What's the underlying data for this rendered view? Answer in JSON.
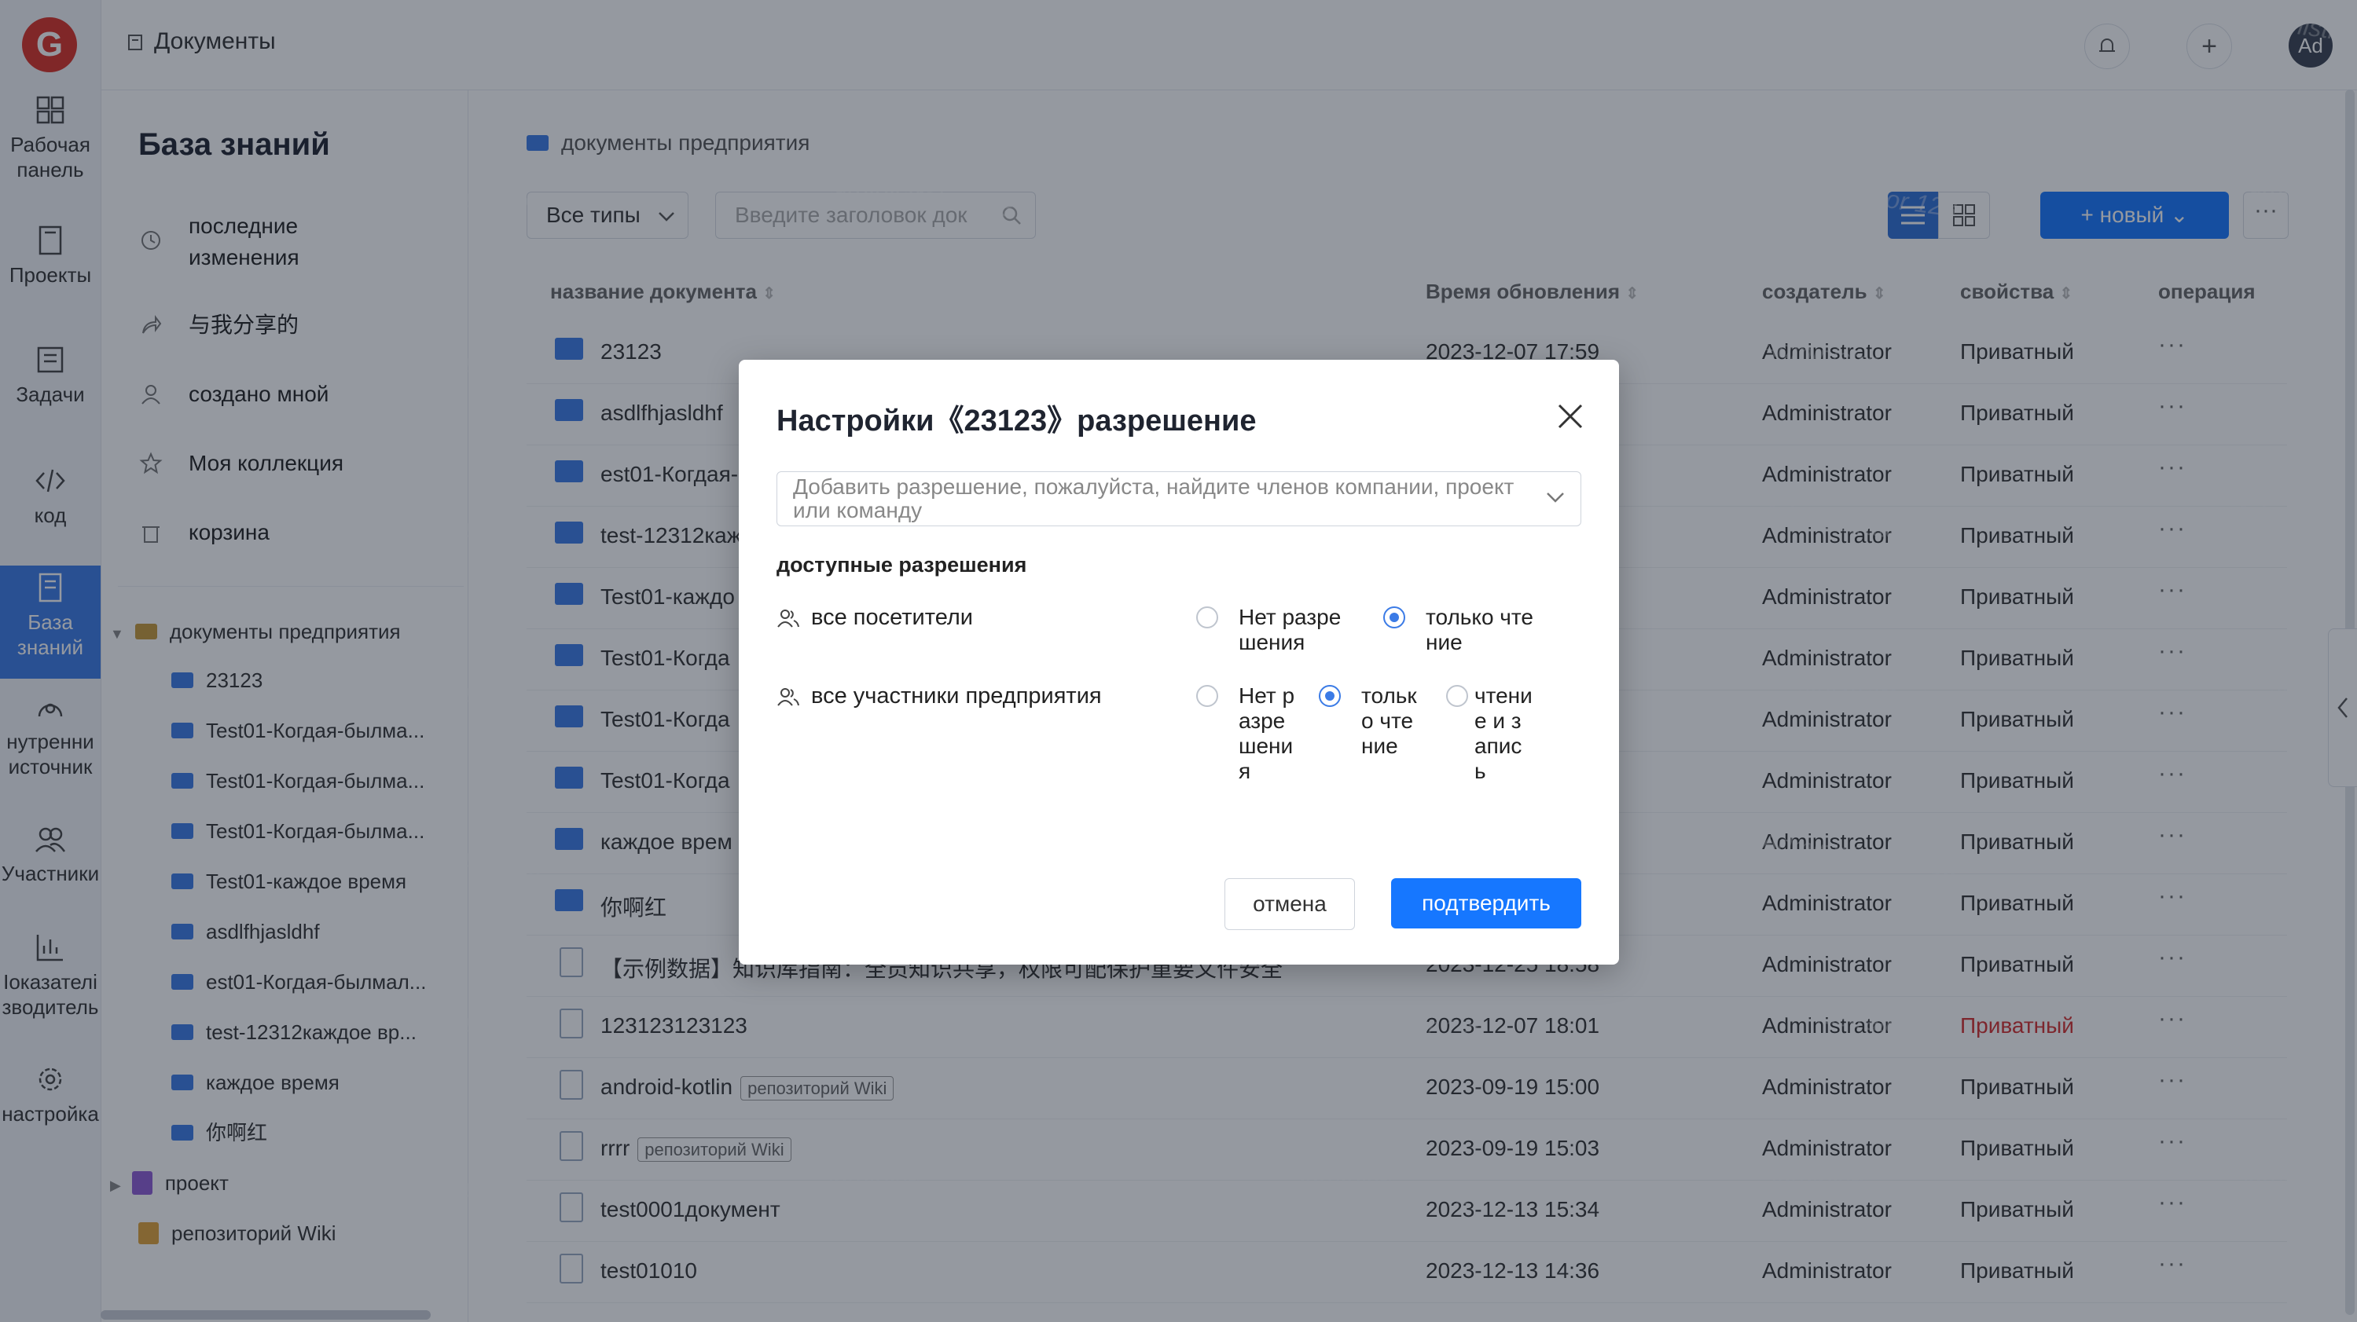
{
  "app": {
    "logo": "G",
    "breadcrumb": "Документы"
  },
  "rail": [
    {
      "label": "Рабочая панель",
      "icon": "dashboard-icon"
    },
    {
      "label": "Проекты",
      "icon": "projects-icon"
    },
    {
      "label": "Задачи",
      "icon": "tasks-icon"
    },
    {
      "label": "код",
      "icon": "code-icon"
    },
    {
      "label": "База знаний",
      "icon": "knowledge-icon"
    },
    {
      "label": "нутренни источник",
      "icon": "source-icon"
    },
    {
      "label": "Участники",
      "icon": "members-icon"
    },
    {
      "label": "Іоказателі зводитель",
      "icon": "metrics-icon"
    },
    {
      "label": "настройка",
      "icon": "settings-icon"
    }
  ],
  "header": {
    "avatar": "Ad"
  },
  "kb": {
    "title": "База знаний",
    "links": [
      {
        "label": "последние изменения",
        "icon": "clock-icon"
      },
      {
        "label": "与我分享的",
        "icon": "share-icon"
      },
      {
        "label": "создано мной",
        "icon": "user-icon"
      },
      {
        "label": "Моя коллекция",
        "icon": "star-icon"
      },
      {
        "label": "корзина",
        "icon": "trash-icon"
      }
    ],
    "tree_root": "документы предприятия",
    "tree": [
      "23123",
      "Test01-Когдая-былма...",
      "Test01-Когдая-былма...",
      "Test01-Когдая-былма...",
      "Test01-каждое время",
      "asdlfhjasldhf",
      "est01-Когдая-былмал...",
      "test-12312каждое вр...",
      "каждое время",
      "你啊红"
    ],
    "project": "проект",
    "wiki": "репозиторий Wiki"
  },
  "main": {
    "breadcrumb": "документы предприятия",
    "type_filter": "Все типы",
    "search_placeholder": "Введите заголовок док",
    "new_button": "+ новый",
    "columns": {
      "name": "название документа",
      "updated": "Время обновления",
      "creator": "создатель",
      "props": "свойства",
      "ops": "операция"
    },
    "rows": [
      {
        "name": "23123",
        "updated": "2023-12-07 17:59",
        "creator": "Administrator",
        "prop": "Приватный",
        "type": "folder"
      },
      {
        "name": "asdlfhjasldhf",
        "updated": "",
        "creator": "Administrator",
        "prop": "Приватный",
        "type": "folder"
      },
      {
        "name": "est01-Когдая-",
        "updated": "",
        "creator": "Administrator",
        "prop": "Приватный",
        "type": "folder"
      },
      {
        "name": "test-12312каж",
        "updated": "",
        "creator": "Administrator",
        "prop": "Приватный",
        "type": "folder"
      },
      {
        "name": "Test01-каждо",
        "updated": "",
        "creator": "Administrator",
        "prop": "Приватный",
        "type": "folder"
      },
      {
        "name": "Test01-Когда",
        "updated": "",
        "creator": "Administrator",
        "prop": "Приватный",
        "type": "folder"
      },
      {
        "name": "Test01-Когда",
        "updated": "",
        "creator": "Administrator",
        "prop": "Приватный",
        "type": "folder"
      },
      {
        "name": "Test01-Когда",
        "updated": "",
        "creator": "Administrator",
        "prop": "Приватный",
        "type": "folder"
      },
      {
        "name": "каждое врем",
        "updated": "",
        "creator": "Administrator",
        "prop": "Приватный",
        "type": "folder"
      },
      {
        "name": "你啊红",
        "updated": "",
        "creator": "Administrator",
        "prop": "Приватный",
        "type": "folder"
      },
      {
        "name": "【示例数据】知识库指南：全员知识共享，权限可配保护重要文件安全",
        "updated": "2023-12-25 18:58",
        "creator": "Administrator",
        "prop": "Приватный",
        "type": "doc"
      },
      {
        "name": "123123123123",
        "updated": "2023-12-07 18:01",
        "creator": "Administrator",
        "prop": "Приватный",
        "type": "doc",
        "red": true
      },
      {
        "name": "android-kotlin",
        "tag": "репозиторий Wiki",
        "updated": "2023-09-19 15:00",
        "creator": "Administrator",
        "prop": "Приватный",
        "type": "doc"
      },
      {
        "name": "rrrr",
        "tag": "репозиторий Wiki",
        "updated": "2023-09-19 15:03",
        "creator": "Administrator",
        "prop": "Приватный",
        "type": "doc"
      },
      {
        "name": "test0001документ",
        "updated": "2023-12-13 15:34",
        "creator": "Administrator",
        "prop": "Приватный",
        "type": "doc"
      },
      {
        "name": "test01010",
        "updated": "2023-12-13 14:36",
        "creator": "Administrator",
        "prop": "Приватный",
        "type": "doc"
      }
    ]
  },
  "watermark": "Administrator 123",
  "modal": {
    "title": "Настройки《23123》разрешение",
    "select_placeholder": "Добавить разрешение, пожалуйста, найдите членов компании, проект или команду",
    "section": "доступные разрешения",
    "groups": [
      {
        "label": "все посетители",
        "options": [
          {
            "label": "Нет разрешения",
            "checked": false
          },
          {
            "label": "только чтение",
            "checked": true
          }
        ]
      },
      {
        "label": "все участники предприятия",
        "options": [
          {
            "label": "Нет разрешения",
            "checked": false
          },
          {
            "label": "только чтение",
            "checked": true
          },
          {
            "label": "чтение и запись",
            "checked": false
          }
        ]
      }
    ],
    "cancel": "отмена",
    "confirm": "подтвердить"
  },
  "colors": {
    "accent": "#1677ff",
    "danger": "#d32f2f"
  }
}
